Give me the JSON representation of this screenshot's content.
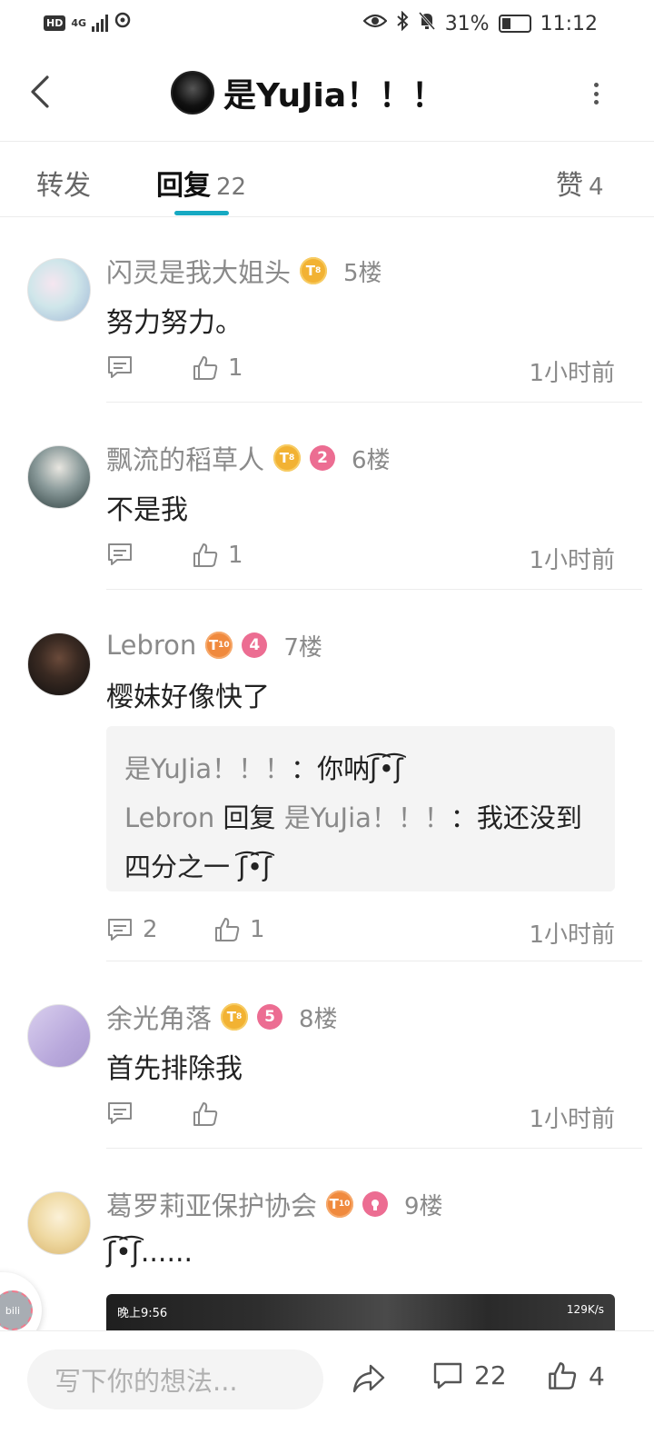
{
  "status_bar": {
    "hd": "HD",
    "network": "4G",
    "battery": "31%",
    "time": "11:12"
  },
  "header": {
    "title": "是YuJia！！！"
  },
  "tabs": [
    {
      "label": "转发",
      "count": ""
    },
    {
      "label": "回复",
      "count": "22"
    },
    {
      "label": "赞",
      "count": "4"
    }
  ],
  "comments": [
    {
      "username": "闪灵是我大姐头",
      "level": "8",
      "floor": "5楼",
      "content": "努力努力。",
      "replies": "",
      "likes": "1",
      "time": "1小时前"
    },
    {
      "username": "飘流的稻草人",
      "level": "8",
      "fan_level": "2",
      "floor": "6楼",
      "content": "不是我",
      "replies": "",
      "likes": "1",
      "time": "1小时前"
    },
    {
      "username": "Lebron",
      "level": "10",
      "fan_level": "4",
      "floor": "7楼",
      "content": "樱妹好像快了",
      "replies": "2",
      "likes": "1",
      "time": "1小时前",
      "subreplies": {
        "r1_name": "是YuJia！！！",
        "r1_text": "：你呐ʃ͡•͡ʃ",
        "r2_name": "Lebron",
        "r2_mid": " 回复 ",
        "r2_target": "是YuJia！！！",
        "r2_text": "：我还没到四分之一 ʃ͡•͡ʃ"
      }
    },
    {
      "username": "余光角落",
      "level": "8",
      "fan_level": "5",
      "floor": "8楼",
      "content": "首先排除我",
      "replies": "",
      "likes": "",
      "time": "1小时前"
    },
    {
      "username": "葛罗莉亚保护协会",
      "level": "10",
      "floor": "9楼",
      "content": "ʃ͡•͡ʃ......"
    }
  ],
  "image_overlay": {
    "left": "晚上9:56",
    "right": "129K/s"
  },
  "bottom_bar": {
    "placeholder": "写下你的想法...",
    "reply_count": "22",
    "like_count": "4"
  },
  "colors": {
    "accent": "#16a9c2",
    "level_gold": "#f2b233",
    "level_orange": "#f08a3e",
    "fan_pink": "#ec6d92"
  }
}
